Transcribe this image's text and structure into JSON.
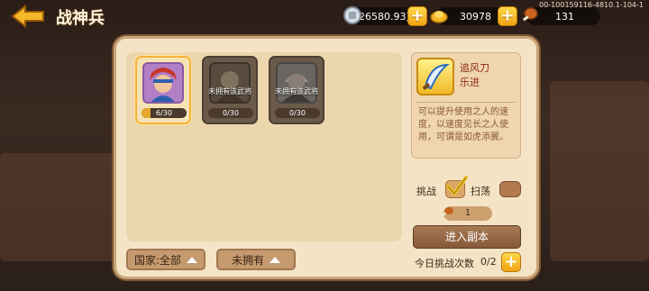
{
  "header": {
    "title": "战神兵",
    "silver": "26580.93万",
    "gold": "30978",
    "stamina": "131",
    "version": "00-100159116-4810.1-104-1"
  },
  "generals": [
    {
      "progress_label": "6/30",
      "progress": 0.2,
      "status": ""
    },
    {
      "progress_label": "0/30",
      "progress": 0,
      "status": "未拥有该武将"
    },
    {
      "progress_label": "0/30",
      "progress": 0,
      "status": "未拥有该武将"
    }
  ],
  "filters": {
    "country_label": "国家:全部",
    "owned_label": "未拥有"
  },
  "detail": {
    "item_name_line1": "追风刀",
    "item_name_line2": "乐进",
    "description": "可以提升使用之人的速度，以速度见长之人使用，可谓是如虎添翼。"
  },
  "actions": {
    "challenge_label": "挑战",
    "sweep_label": "扫荡",
    "cost_count": "1",
    "enter_label": "进入副本",
    "daily_label": "今日挑战次数",
    "daily_value": "0/2"
  },
  "colors": {
    "accent": "#f0a413",
    "panel": "#f4e4c5",
    "title_text": "#fff6dc"
  }
}
